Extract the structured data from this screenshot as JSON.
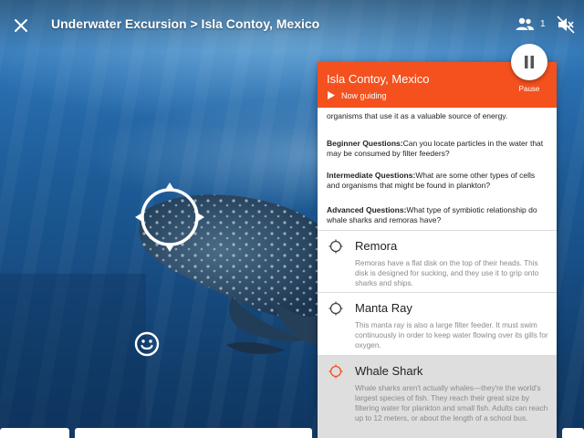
{
  "header": {
    "title": "Underwater Excursion > Isla Contoy, Mexico",
    "participant_count": "1",
    "icons": {
      "close": "close-icon",
      "people": "people-icon",
      "mute": "volume-off-icon"
    }
  },
  "scene": {
    "description_icon": "emoji-icon",
    "reticle_icon": "crosshair-icon"
  },
  "pause": {
    "label": "Pause",
    "icon": "pause-icon"
  },
  "panel": {
    "title": "Isla Contoy, Mexico",
    "status": "Now guiding",
    "accent": "#f4511e",
    "intro_tail": "organisms that use it as a valuable source of energy.",
    "questions": [
      {
        "level": "Beginner Questions:",
        "text": "Can you locate particles in the water that may be consumed by filter feeders?"
      },
      {
        "level": "Intermediate Questions:",
        "text": "What are some other types of cells and organisms that might be found in plankton?"
      },
      {
        "level": "Advanced Questions:",
        "text": "What type of symbiotic relationship do whale sharks and remoras have?"
      }
    ],
    "items": [
      {
        "name": "Remora",
        "desc": "Remoras have a flat disk on the top of their heads. This disk is designed for sucking, and they use it to grip onto sharks and ships."
      },
      {
        "name": "Manta Ray",
        "desc": "This manta ray is also a large filter feeder. It must swim continuously in order to keep water flowing over its gills for oxygen."
      },
      {
        "name": "Whale Shark",
        "desc": "Whale sharks aren't actually whales—they're the world's largest species of fish. They reach their great size by filtering water for plankton and small fish. Adults can reach up to 12 meters, or about the length of a school bus."
      }
    ]
  }
}
